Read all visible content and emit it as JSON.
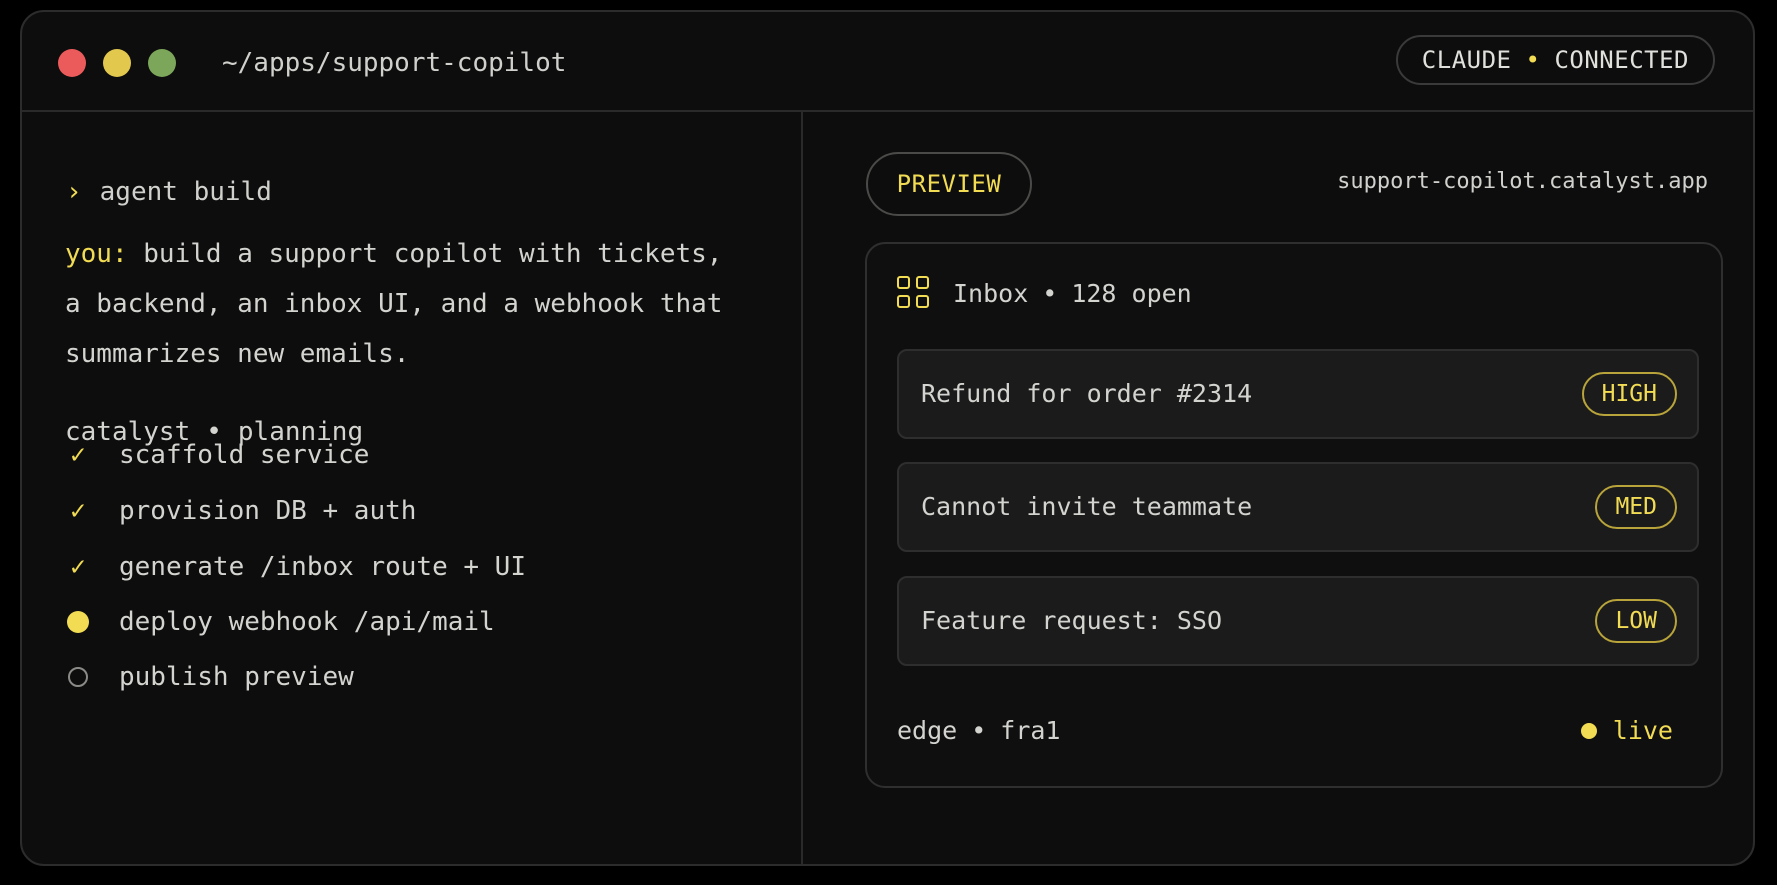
{
  "window": {
    "path": "~/apps/support-copilot",
    "status": {
      "left": "CLAUDE",
      "separator": "•",
      "right": "CONNECTED"
    }
  },
  "terminal": {
    "prompt_symbol": "›",
    "command": "agent build",
    "message_prefix": "you:",
    "message": " build a support copilot with tickets, a backend, an inbox UI, and a webhook that summarizes new emails.",
    "planning": {
      "name": "catalyst",
      "separator": "•",
      "state": "planning"
    },
    "steps": [
      {
        "label": "scaffold service",
        "status": "done"
      },
      {
        "label": "provision DB + auth",
        "status": "done"
      },
      {
        "label": "generate /inbox route + UI",
        "status": "done"
      },
      {
        "label": "deploy webhook /api/mail",
        "status": "in-progress"
      },
      {
        "label": "publish preview",
        "status": "pending"
      }
    ]
  },
  "preview": {
    "button_label": "PREVIEW",
    "url": "support-copilot.catalyst.app",
    "inbox": {
      "title": "Inbox",
      "separator": "•",
      "count_label": "128 open"
    },
    "tickets": [
      {
        "title": "Refund for order #2314",
        "priority": "HIGH"
      },
      {
        "title": "Cannot invite teammate",
        "priority": "MED"
      },
      {
        "title": "Feature request: SSO",
        "priority": "LOW"
      }
    ],
    "footer": {
      "edge": "edge",
      "separator": "•",
      "region": "fra1",
      "status": "live"
    }
  },
  "colors": {
    "accent": "#f2dc54",
    "background": "#0d0d0d",
    "traffic_red": "#ec5b5b",
    "traffic_yellow": "#e2c84d",
    "traffic_green": "#7ca65a"
  }
}
